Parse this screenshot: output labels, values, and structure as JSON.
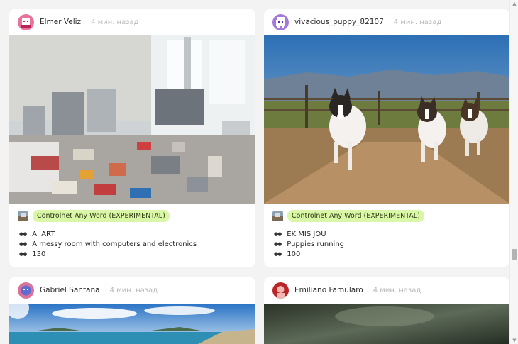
{
  "feed": {
    "cards": [
      {
        "author": "Elmer Veliz",
        "time": "4 мин. назад",
        "tag": "Controlnet Any Word (EXPERIMENTAL)",
        "params": [
          "AI ART",
          "A messy room with computers and electronics",
          "130"
        ]
      },
      {
        "author": "vivacious_puppy_82107",
        "time": "4 мин. назад",
        "tag": "Controlnet Any Word (EXPERIMENTAL)",
        "params": [
          "EK MIS JOU",
          "Puppies running",
          "100"
        ]
      },
      {
        "author": "Gabriel Santana",
        "time": "4 мин. назад"
      },
      {
        "author": "Emiliano Famularo",
        "time": "4 мин. назад"
      }
    ]
  },
  "scrollbar": {
    "up_icon": "triangle-up-icon",
    "down_icon": "triangle-down-icon"
  },
  "colors": {
    "tag_background": "#d9f7a6",
    "page_background": "#f3f3f3"
  }
}
